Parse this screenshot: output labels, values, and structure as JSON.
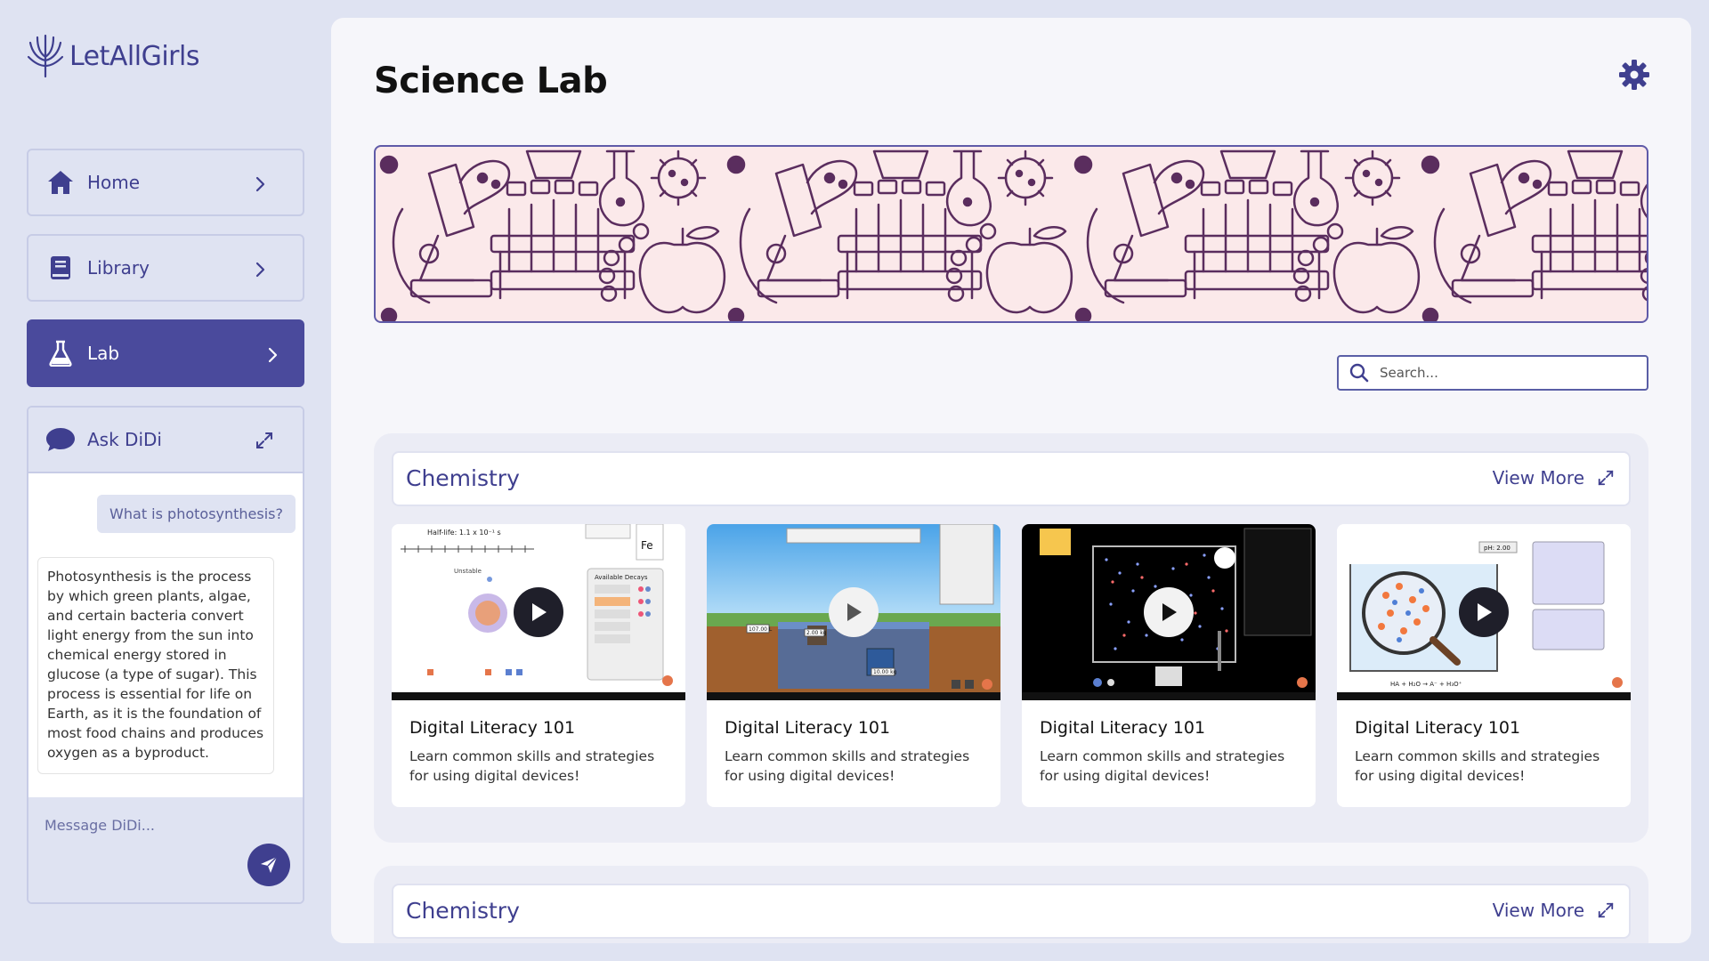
{
  "brand": {
    "name": "LetAllGirls"
  },
  "sidebar": {
    "items": [
      {
        "label": "Home",
        "icon": "home-icon"
      },
      {
        "label": "Library",
        "icon": "book-icon"
      },
      {
        "label": "Lab",
        "icon": "flask-icon",
        "active": true
      }
    ]
  },
  "chat": {
    "title": "Ask DiDi",
    "user_message": "What is photosynthesis?",
    "bot_message": "Photosynthesis is the process by which green plants, algae, and certain bacteria convert light energy from the sun into chemical energy stored in glucose (a type of sugar). This process is essential for life on Earth, as it is the foundation of most food chains and produces oxygen as a byproduct.",
    "input_placeholder": "Message DiDi..."
  },
  "main": {
    "title": "Science Lab",
    "search_placeholder": "Search..."
  },
  "sections": [
    {
      "title": "Chemistry",
      "view_more": "View More",
      "cards": [
        {
          "title": "Digital Literacy 101",
          "description": "Learn common skills and strategies for using digital devices!",
          "thumb": "decay-sim"
        },
        {
          "title": "Digital Literacy 101",
          "description": "Learn common skills and strategies for using digital devices!",
          "thumb": "density-sim"
        },
        {
          "title": "Digital Literacy 101",
          "description": "Learn common skills and strategies for using digital devices!",
          "thumb": "gas-sim"
        },
        {
          "title": "Digital Literacy 101",
          "description": "Learn common skills and strategies for using digital devices!",
          "thumb": "acid-base-sim"
        }
      ]
    },
    {
      "title": "Chemistry",
      "view_more": "View More"
    }
  ],
  "thumb_text": {
    "half_life": "Half-life: 1.1 x 10⁻¹ s",
    "element_symbol": "Fe",
    "decays_title": "Available Decays",
    "mass_1": "107.00 L",
    "mass_2": "2.00 kg",
    "mass_3": "10.00 kg",
    "ph": "pH: 2.00",
    "equation": "HA + H₂O → A⁻ + H₃O⁺"
  },
  "colors": {
    "accent": "#3f3f8f",
    "active_nav": "#4a4a9c",
    "background": "#dfe3f2",
    "banner_bg": "#fbe9ea",
    "banner_line": "#5f5aa8"
  }
}
